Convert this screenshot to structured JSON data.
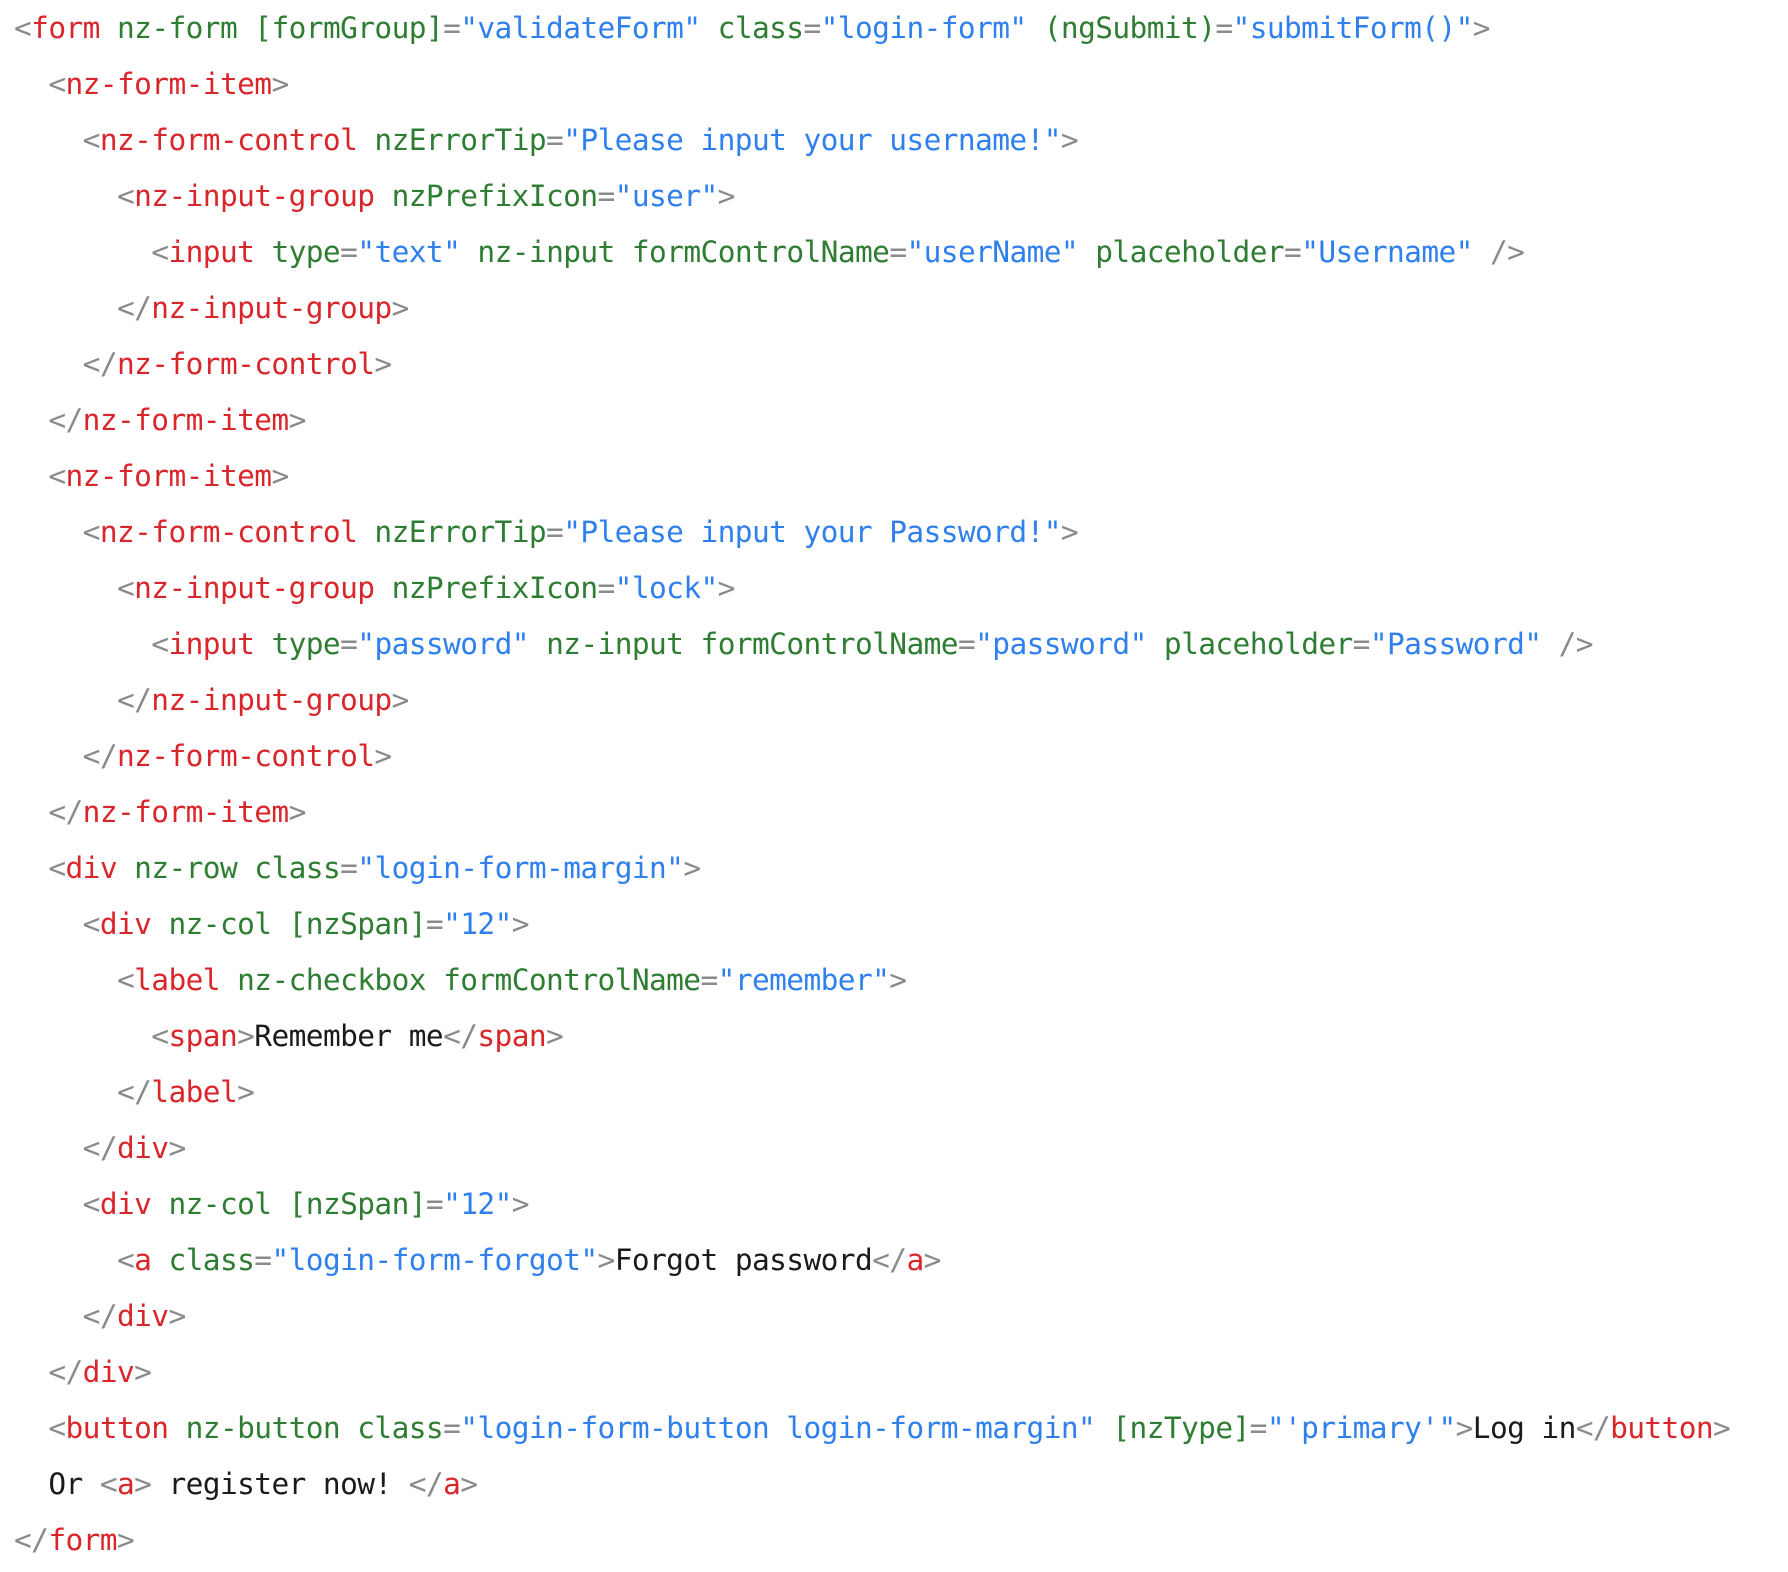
{
  "colors": {
    "punct": "#8a8a8a",
    "tag": "#d9262a",
    "attr": "#2e7d32",
    "string": "#2f80ed",
    "text": "#1a1a1a",
    "background": "#ffffff"
  },
  "code": {
    "lines": [
      [
        [
          "p",
          "<"
        ],
        [
          "t",
          "form"
        ],
        [
          "x",
          " "
        ],
        [
          "a",
          "nz-form"
        ],
        [
          "x",
          " "
        ],
        [
          "a",
          "[formGroup]"
        ],
        [
          "p",
          "="
        ],
        [
          "s",
          "\"validateForm\""
        ],
        [
          "x",
          " "
        ],
        [
          "a",
          "class"
        ],
        [
          "p",
          "="
        ],
        [
          "s",
          "\"login-form\""
        ],
        [
          "x",
          " "
        ],
        [
          "a",
          "(ngSubmit)"
        ],
        [
          "p",
          "="
        ],
        [
          "s",
          "\"submitForm()\""
        ],
        [
          "p",
          ">"
        ]
      ],
      [
        [
          "x",
          "  "
        ],
        [
          "p",
          "<"
        ],
        [
          "t",
          "nz-form-item"
        ],
        [
          "p",
          ">"
        ]
      ],
      [
        [
          "x",
          "    "
        ],
        [
          "p",
          "<"
        ],
        [
          "t",
          "nz-form-control"
        ],
        [
          "x",
          " "
        ],
        [
          "a",
          "nzErrorTip"
        ],
        [
          "p",
          "="
        ],
        [
          "s",
          "\"Please input your username!\""
        ],
        [
          "p",
          ">"
        ]
      ],
      [
        [
          "x",
          "      "
        ],
        [
          "p",
          "<"
        ],
        [
          "t",
          "nz-input-group"
        ],
        [
          "x",
          " "
        ],
        [
          "a",
          "nzPrefixIcon"
        ],
        [
          "p",
          "="
        ],
        [
          "s",
          "\"user\""
        ],
        [
          "p",
          ">"
        ]
      ],
      [
        [
          "x",
          "        "
        ],
        [
          "p",
          "<"
        ],
        [
          "t",
          "input"
        ],
        [
          "x",
          " "
        ],
        [
          "a",
          "type"
        ],
        [
          "p",
          "="
        ],
        [
          "s",
          "\"text\""
        ],
        [
          "x",
          " "
        ],
        [
          "a",
          "nz-input"
        ],
        [
          "x",
          " "
        ],
        [
          "a",
          "formControlName"
        ],
        [
          "p",
          "="
        ],
        [
          "s",
          "\"userName\""
        ],
        [
          "x",
          " "
        ],
        [
          "a",
          "placeholder"
        ],
        [
          "p",
          "="
        ],
        [
          "s",
          "\"Username\""
        ],
        [
          "x",
          " "
        ],
        [
          "p",
          "/>"
        ]
      ],
      [
        [
          "x",
          "      "
        ],
        [
          "p",
          "</"
        ],
        [
          "t",
          "nz-input-group"
        ],
        [
          "p",
          ">"
        ]
      ],
      [
        [
          "x",
          "    "
        ],
        [
          "p",
          "</"
        ],
        [
          "t",
          "nz-form-control"
        ],
        [
          "p",
          ">"
        ]
      ],
      [
        [
          "x",
          "  "
        ],
        [
          "p",
          "</"
        ],
        [
          "t",
          "nz-form-item"
        ],
        [
          "p",
          ">"
        ]
      ],
      [
        [
          "x",
          "  "
        ],
        [
          "p",
          "<"
        ],
        [
          "t",
          "nz-form-item"
        ],
        [
          "p",
          ">"
        ]
      ],
      [
        [
          "x",
          "    "
        ],
        [
          "p",
          "<"
        ],
        [
          "t",
          "nz-form-control"
        ],
        [
          "x",
          " "
        ],
        [
          "a",
          "nzErrorTip"
        ],
        [
          "p",
          "="
        ],
        [
          "s",
          "\"Please input your Password!\""
        ],
        [
          "p",
          ">"
        ]
      ],
      [
        [
          "x",
          "      "
        ],
        [
          "p",
          "<"
        ],
        [
          "t",
          "nz-input-group"
        ],
        [
          "x",
          " "
        ],
        [
          "a",
          "nzPrefixIcon"
        ],
        [
          "p",
          "="
        ],
        [
          "s",
          "\"lock\""
        ],
        [
          "p",
          ">"
        ]
      ],
      [
        [
          "x",
          "        "
        ],
        [
          "p",
          "<"
        ],
        [
          "t",
          "input"
        ],
        [
          "x",
          " "
        ],
        [
          "a",
          "type"
        ],
        [
          "p",
          "="
        ],
        [
          "s",
          "\"password\""
        ],
        [
          "x",
          " "
        ],
        [
          "a",
          "nz-input"
        ],
        [
          "x",
          " "
        ],
        [
          "a",
          "formControlName"
        ],
        [
          "p",
          "="
        ],
        [
          "s",
          "\"password\""
        ],
        [
          "x",
          " "
        ],
        [
          "a",
          "placeholder"
        ],
        [
          "p",
          "="
        ],
        [
          "s",
          "\"Password\""
        ],
        [
          "x",
          " "
        ],
        [
          "p",
          "/>"
        ]
      ],
      [
        [
          "x",
          "      "
        ],
        [
          "p",
          "</"
        ],
        [
          "t",
          "nz-input-group"
        ],
        [
          "p",
          ">"
        ]
      ],
      [
        [
          "x",
          "    "
        ],
        [
          "p",
          "</"
        ],
        [
          "t",
          "nz-form-control"
        ],
        [
          "p",
          ">"
        ]
      ],
      [
        [
          "x",
          "  "
        ],
        [
          "p",
          "</"
        ],
        [
          "t",
          "nz-form-item"
        ],
        [
          "p",
          ">"
        ]
      ],
      [
        [
          "x",
          "  "
        ],
        [
          "p",
          "<"
        ],
        [
          "t",
          "div"
        ],
        [
          "x",
          " "
        ],
        [
          "a",
          "nz-row"
        ],
        [
          "x",
          " "
        ],
        [
          "a",
          "class"
        ],
        [
          "p",
          "="
        ],
        [
          "s",
          "\"login-form-margin\""
        ],
        [
          "p",
          ">"
        ]
      ],
      [
        [
          "x",
          "    "
        ],
        [
          "p",
          "<"
        ],
        [
          "t",
          "div"
        ],
        [
          "x",
          " "
        ],
        [
          "a",
          "nz-col"
        ],
        [
          "x",
          " "
        ],
        [
          "a",
          "[nzSpan]"
        ],
        [
          "p",
          "="
        ],
        [
          "s",
          "\"12\""
        ],
        [
          "p",
          ">"
        ]
      ],
      [
        [
          "x",
          "      "
        ],
        [
          "p",
          "<"
        ],
        [
          "t",
          "label"
        ],
        [
          "x",
          " "
        ],
        [
          "a",
          "nz-checkbox"
        ],
        [
          "x",
          " "
        ],
        [
          "a",
          "formControlName"
        ],
        [
          "p",
          "="
        ],
        [
          "s",
          "\"remember\""
        ],
        [
          "p",
          ">"
        ]
      ],
      [
        [
          "x",
          "        "
        ],
        [
          "p",
          "<"
        ],
        [
          "t",
          "span"
        ],
        [
          "p",
          ">"
        ],
        [
          "x",
          "Remember me"
        ],
        [
          "p",
          "</"
        ],
        [
          "t",
          "span"
        ],
        [
          "p",
          ">"
        ]
      ],
      [
        [
          "x",
          "      "
        ],
        [
          "p",
          "</"
        ],
        [
          "t",
          "label"
        ],
        [
          "p",
          ">"
        ]
      ],
      [
        [
          "x",
          "    "
        ],
        [
          "p",
          "</"
        ],
        [
          "t",
          "div"
        ],
        [
          "p",
          ">"
        ]
      ],
      [
        [
          "x",
          "    "
        ],
        [
          "p",
          "<"
        ],
        [
          "t",
          "div"
        ],
        [
          "x",
          " "
        ],
        [
          "a",
          "nz-col"
        ],
        [
          "x",
          " "
        ],
        [
          "a",
          "[nzSpan]"
        ],
        [
          "p",
          "="
        ],
        [
          "s",
          "\"12\""
        ],
        [
          "p",
          ">"
        ]
      ],
      [
        [
          "x",
          "      "
        ],
        [
          "p",
          "<"
        ],
        [
          "t",
          "a"
        ],
        [
          "x",
          " "
        ],
        [
          "a",
          "class"
        ],
        [
          "p",
          "="
        ],
        [
          "s",
          "\"login-form-forgot\""
        ],
        [
          "p",
          ">"
        ],
        [
          "x",
          "Forgot password"
        ],
        [
          "p",
          "</"
        ],
        [
          "t",
          "a"
        ],
        [
          "p",
          ">"
        ]
      ],
      [
        [
          "x",
          "    "
        ],
        [
          "p",
          "</"
        ],
        [
          "t",
          "div"
        ],
        [
          "p",
          ">"
        ]
      ],
      [
        [
          "x",
          "  "
        ],
        [
          "p",
          "</"
        ],
        [
          "t",
          "div"
        ],
        [
          "p",
          ">"
        ]
      ],
      [
        [
          "x",
          "  "
        ],
        [
          "p",
          "<"
        ],
        [
          "t",
          "button"
        ],
        [
          "x",
          " "
        ],
        [
          "a",
          "nz-button"
        ],
        [
          "x",
          " "
        ],
        [
          "a",
          "class"
        ],
        [
          "p",
          "="
        ],
        [
          "s",
          "\"login-form-button login-form-margin\""
        ],
        [
          "x",
          " "
        ],
        [
          "a",
          "[nzType]"
        ],
        [
          "p",
          "="
        ],
        [
          "s",
          "\"'primary'\""
        ],
        [
          "p",
          ">"
        ],
        [
          "x",
          "Log in"
        ],
        [
          "p",
          "</"
        ],
        [
          "t",
          "button"
        ],
        [
          "p",
          ">"
        ]
      ],
      [
        [
          "x",
          "  Or "
        ],
        [
          "p",
          "<"
        ],
        [
          "t",
          "a"
        ],
        [
          "p",
          ">"
        ],
        [
          "x",
          " register now! "
        ],
        [
          "p",
          "</"
        ],
        [
          "t",
          "a"
        ],
        [
          "p",
          ">"
        ]
      ],
      [
        [
          "p",
          "</"
        ],
        [
          "t",
          "form"
        ],
        [
          "p",
          ">"
        ]
      ]
    ]
  }
}
